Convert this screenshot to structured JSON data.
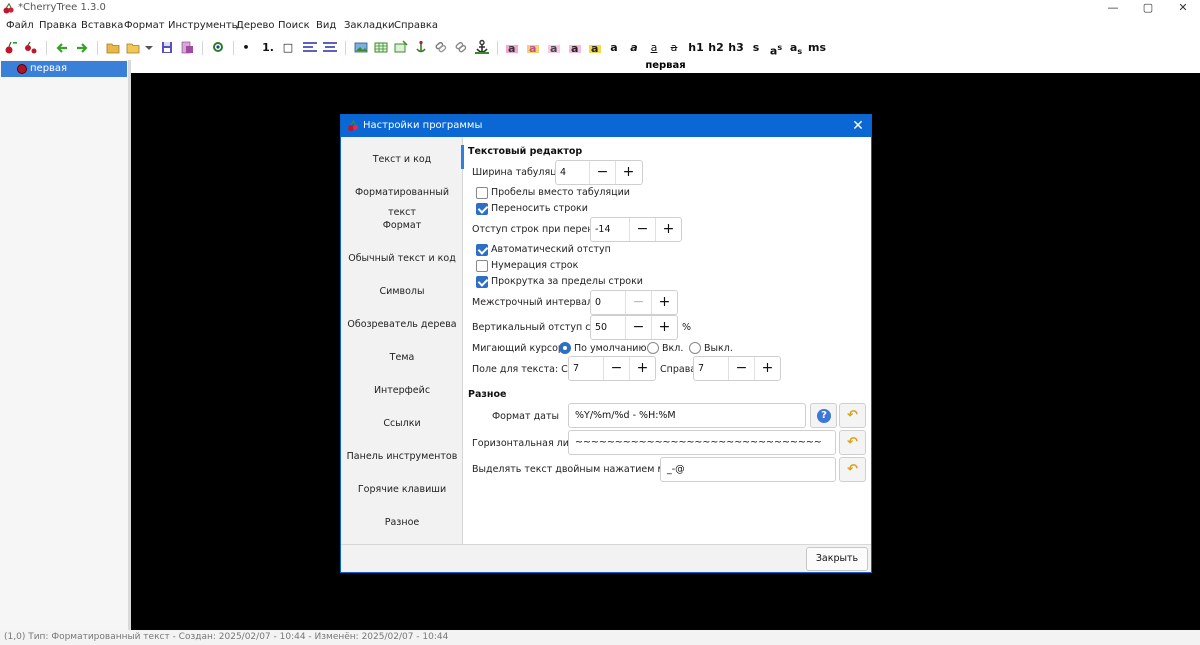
{
  "window": {
    "title": "*CherryTree 1.3.0"
  },
  "menu": [
    "Файл",
    "Правка",
    "Вставка",
    "Формат",
    "Инструменты",
    "Дерево",
    "Поиск",
    "Вид",
    "Закладки",
    "Справка"
  ],
  "toolbar": {
    "bullet": "•",
    "numbered": "1.",
    "todo": "□",
    "h1": "h1",
    "h2": "h2",
    "h3": "h3",
    "small": "s",
    "sup": "a",
    "sup_mark": "s",
    "sub": "a",
    "sub_mark": "s",
    "mono": "ms",
    "bold": "a",
    "italic": "a",
    "underline": "a",
    "strike": "a"
  },
  "tree": {
    "selected_node": "первая"
  },
  "editor": {
    "node_title": "первая"
  },
  "status": "(1,0)   Тип: Форматированный текст  -  Создан: 2025/02/07 - 10:44  -  Изменён: 2025/02/07 - 10:44",
  "dialog": {
    "title": "Настройки программы",
    "sidebar": [
      "Текст и код",
      "Форматированный текст",
      "Формат",
      "Обычный текст и код",
      "Символы",
      "Обозреватель дерева",
      "Тема",
      "Интерфейс",
      "Ссылки",
      "Панель инструментов",
      "Горячие клавиши",
      "Разное"
    ],
    "active_section": "Текст и код",
    "text_editor": {
      "title": "Текстовый редактор",
      "tab_width_label": "Ширина табуляции",
      "tab_width": "4",
      "spaces_instead_tabs": {
        "label": "Пробелы вместо табуляции",
        "checked": false
      },
      "wrap_lines": {
        "label": "Переносить строки",
        "checked": true
      },
      "wrap_indent_label": "Отступ строк при переносе",
      "wrap_indent": "-14",
      "auto_indent": {
        "label": "Автоматический отступ",
        "checked": true
      },
      "line_numbers": {
        "label": "Нумерация строк",
        "checked": false
      },
      "scroll_beyond": {
        "label": "Прокрутка за пределы строки",
        "checked": true
      },
      "line_spacing_label": "Межстрочный интервал",
      "line_spacing": "0",
      "vertical_margin_label": "Вертикальный отступ строк",
      "vertical_margin": "50",
      "vertical_margin_unit": "%",
      "cursor_blink_label": "Мигающий курсор",
      "cursor_options": [
        "По умолчанию",
        "Вкл.",
        "Выкл."
      ],
      "cursor_selected": "По умолчанию",
      "margin_left_label": "Поле для текста: Слева",
      "margin_left": "7",
      "margin_right_label": "Справа",
      "margin_right": "7"
    },
    "misc": {
      "title": "Разное",
      "date_format_label": "Формат даты",
      "date_format": "%Y/%m/%d - %H:%M",
      "hr_label": "Горизонтальная линия",
      "hr_value": "~~~~~~~~~~~~~~~~~~~~~~~~~~~~~~~",
      "dblclick_label": "Выделять текст двойным нажатием мыши до",
      "dblclick_value": "_-@"
    },
    "close_button": "Закрыть"
  }
}
